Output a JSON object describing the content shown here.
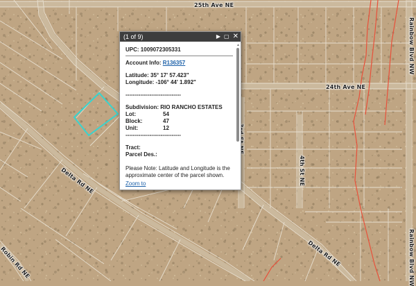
{
  "map": {
    "streets": {
      "ave_25": "25th Ave NE",
      "ave_24": "24th Ave NE",
      "st_3rd": "3rd St NE",
      "st_4th": "4th St NE",
      "rainbow_top": "Rainbow Blvd NW",
      "rainbow_bottom": "Rainbow Blvd NW",
      "delta_left": "Delta Rd NE",
      "delta_right": "Delta Rd NE",
      "robin": "Robin Rd NE"
    },
    "colors": {
      "terrain": "#bfa583",
      "parcel_lines": "#e9e3d6",
      "road": "#c8b59a",
      "selected_parcel": "#37d4cf",
      "boundary": "#e8503a"
    }
  },
  "popup": {
    "counter": "(1 of 9)",
    "upc_label": "UPC:",
    "upc_value": "1009072305331",
    "account_label": "Account Info:",
    "account_link": "R136357",
    "latitude": "Latitude: 35° 17' 57.423\"",
    "longitude": "Longitude: -106° 44' 1.892\"",
    "divider": "------------------------------",
    "subdivision_label": "Subdivision:",
    "subdivision_value": "RIO RANCHO ESTATES",
    "lot_label": "Lot:",
    "lot_value": "54",
    "block_label": "Block:",
    "block_value": "47",
    "unit_label": "Unit:",
    "unit_value": "12",
    "divider2": "------------------------------",
    "tract_label": "Tract:",
    "parcel_des_label": "Parcel Des.:",
    "note": "Please Note: Latitude and Longitude is the approximate center of the parcel shown.",
    "zoom_link": "Zoom to",
    "next_icon": "play-next-icon",
    "maximize_icon": "maximize-icon",
    "close_icon": "close-icon"
  }
}
